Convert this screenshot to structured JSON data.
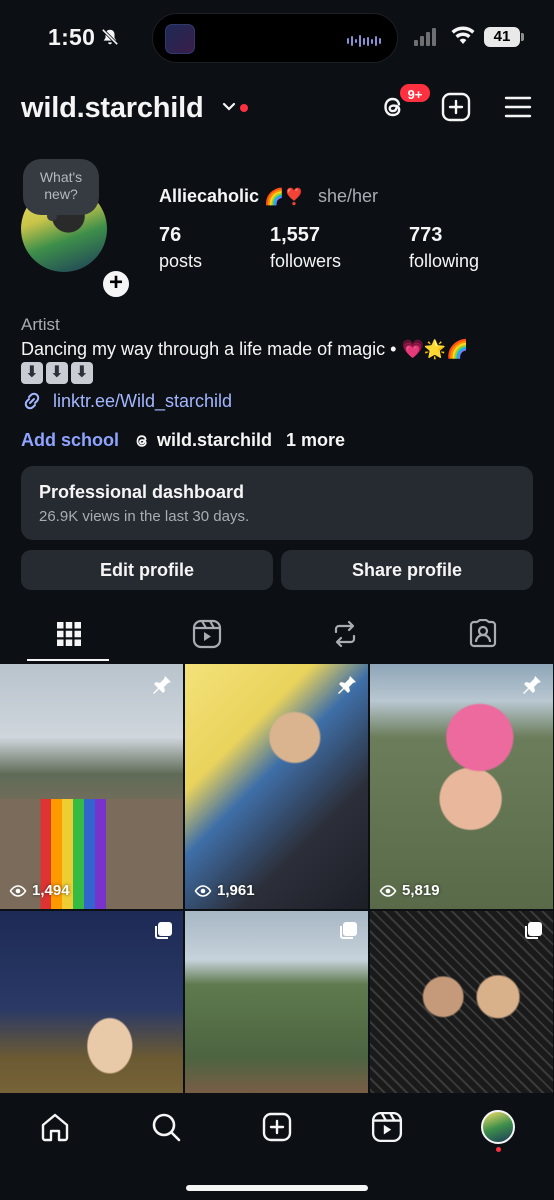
{
  "status_bar": {
    "time": "1:50",
    "battery": "41"
  },
  "header": {
    "username": "wild.starchild",
    "threads_badge": "9+"
  },
  "profile": {
    "note": "What's new?",
    "display_name": "Alliecaholic",
    "name_emojis": "🌈❣️",
    "pronouns": "she/her",
    "stats": [
      {
        "value": "76",
        "label": "posts"
      },
      {
        "value": "1,557",
        "label": "followers"
      },
      {
        "value": "773",
        "label": "following"
      }
    ],
    "category": "Artist",
    "bio": "Dancing my way through a life made of magic • 💗🌟🌈",
    "bio_arrows": [
      "⬇",
      "⬇",
      "⬇"
    ],
    "link": "linktr.ee/Wild_starchild",
    "add_school": "Add school",
    "threads_handle": "wild.starchild",
    "more": "1 more"
  },
  "dashboard": {
    "title": "Professional dashboard",
    "subtitle": "26.9K views in the last 30 days."
  },
  "buttons": {
    "edit": "Edit profile",
    "share": "Share profile"
  },
  "tabs": [
    "posts-grid-icon",
    "reels-icon",
    "reposts-icon",
    "tagged-icon"
  ],
  "posts": [
    {
      "views": "1,494",
      "badge": "pin-icon"
    },
    {
      "views": "1,961",
      "badge": "pin-icon"
    },
    {
      "views": "5,819",
      "badge": "pin-icon"
    },
    {
      "views": "",
      "badge": "carousel-icon"
    },
    {
      "views": "",
      "badge": "carousel-icon"
    },
    {
      "views": "",
      "badge": "carousel-icon"
    }
  ],
  "bottom_nav": [
    "home-icon",
    "search-icon",
    "create-icon",
    "reels-icon",
    "profile-avatar"
  ]
}
